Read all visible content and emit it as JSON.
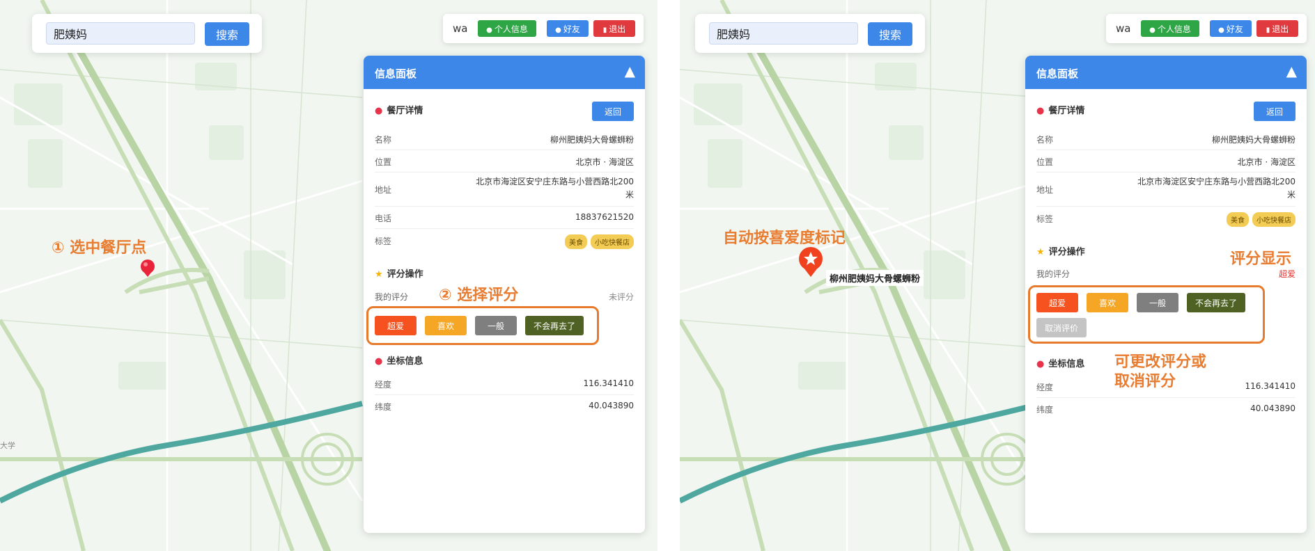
{
  "left": {
    "search": {
      "value": "肥姨妈",
      "button": "搜索"
    },
    "user": {
      "name": "wa",
      "profile": "个人信息",
      "friends": "好友",
      "logout": "退出"
    },
    "panel": {
      "title": "信息面板",
      "toggle": "▲",
      "detail_title": "餐厅详情",
      "back": "返回",
      "rows": {
        "name": {
          "label": "名称",
          "value": "柳州肥姨妈大骨螺蛳粉"
        },
        "location": {
          "label": "位置",
          "value": "北京市 · 海淀区"
        },
        "address": {
          "label": "地址",
          "value": "北京市海淀区安宁庄东路与小营西路北200米"
        },
        "phone": {
          "label": "电话",
          "value": "18837621520"
        },
        "tags": {
          "label": "标签",
          "values": [
            "美食",
            "小吃快餐店"
          ]
        }
      },
      "rating_title": "评分操作",
      "my_rating_label": "我的评分",
      "my_rating_value": "未评分",
      "rating_buttons": [
        "超爱",
        "喜欢",
        "一般",
        "不会再去了"
      ],
      "coords_title": "坐标信息",
      "lng": {
        "label": "经度",
        "value": "116.341410"
      },
      "lat": {
        "label": "纬度",
        "value": "40.043890"
      }
    },
    "annotations": {
      "step1": "① 选中餐厅点",
      "step2": "② 选择评分"
    },
    "map_text": "大学"
  },
  "right": {
    "search": {
      "value": "肥姨妈",
      "button": "搜索"
    },
    "user": {
      "name": "wa",
      "profile": "个人信息",
      "friends": "好友",
      "logout": "退出"
    },
    "panel": {
      "title": "信息面板",
      "toggle": "▲",
      "detail_title": "餐厅详情",
      "back": "返回",
      "rows": {
        "name": {
          "label": "名称",
          "value": "柳州肥姨妈大骨螺蛳粉"
        },
        "location": {
          "label": "位置",
          "value": "北京市 · 海淀区"
        },
        "address": {
          "label": "地址",
          "value": "北京市海淀区安宁庄东路与小营西路北200米"
        },
        "tags": {
          "label": "标签",
          "values": [
            "美食",
            "小吃快餐店"
          ]
        }
      },
      "rating_title": "评分操作",
      "my_rating_label": "我的评分",
      "my_rating_value": "超爱",
      "rating_buttons": [
        "超爱",
        "喜欢",
        "一般",
        "不会再去了"
      ],
      "cancel_rating": "取消评价",
      "coords_title": "坐标信息",
      "lng": {
        "label": "经度",
        "value": "116.341410"
      },
      "lat": {
        "label": "纬度",
        "value": "40.043890"
      }
    },
    "marker_label": "柳州肥姨妈大骨螺蛳粉",
    "annotations": {
      "auto_mark": "自动按喜爱度标记",
      "rating_display": "评分显示",
      "change_line1": "可更改评分或",
      "change_line2": "取消评分"
    }
  },
  "colors": {
    "accent": "#3d87e8",
    "annotation": "#e87c30",
    "love": "#f5521f",
    "like": "#f4a624",
    "ok": "#7f7f7f",
    "never": "#4f6223",
    "cancel": "#c4c4c4",
    "road": "#b8d4a4",
    "river": "#4fa8a0"
  },
  "icons": [
    "user-icon",
    "friends-icon",
    "logout-icon",
    "pin-icon",
    "star-icon",
    "marker-icon",
    "star-marker-icon",
    "collapse-icon"
  ]
}
